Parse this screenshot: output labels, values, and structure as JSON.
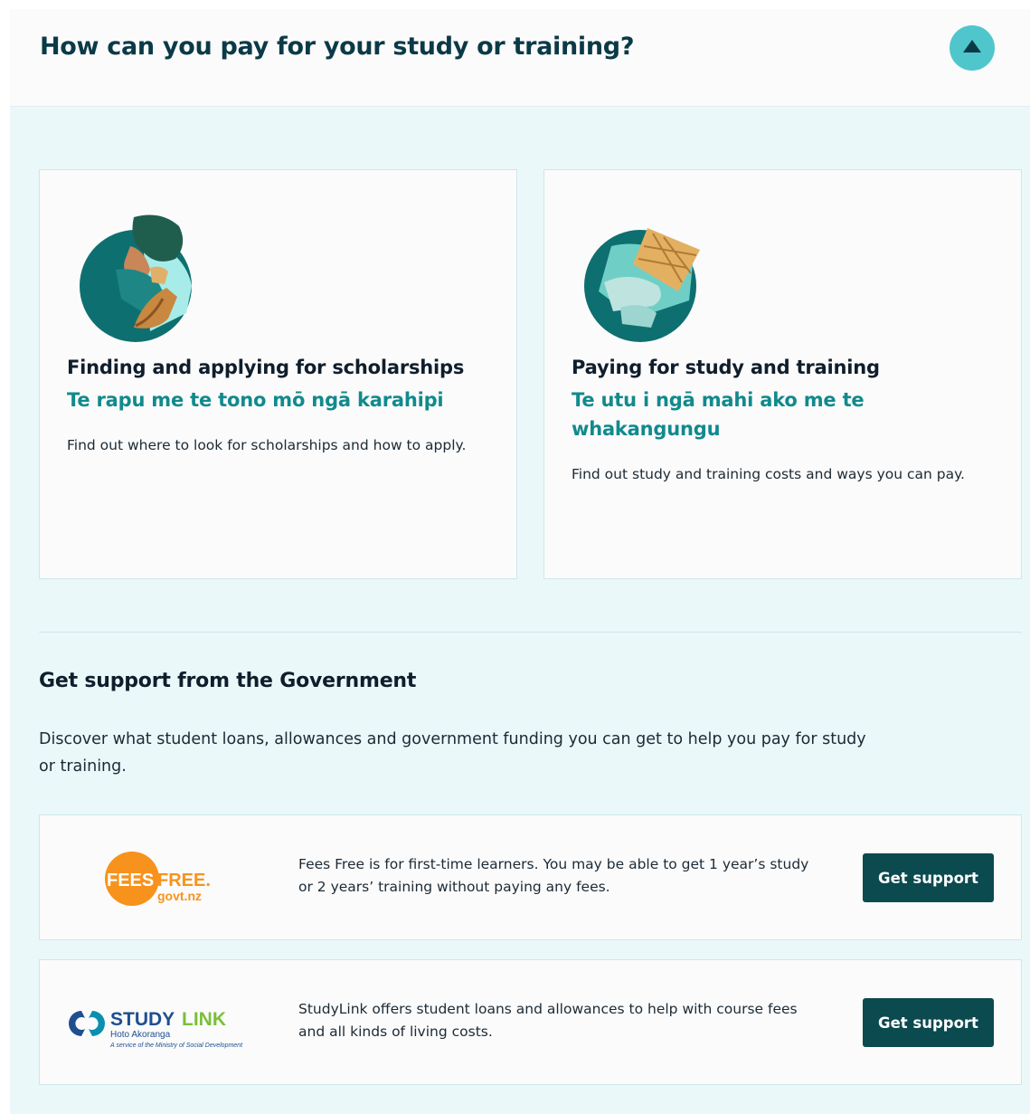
{
  "accordion": {
    "title": "How can you pay for your study or training?"
  },
  "cards": [
    {
      "title_en": "Finding and applying for scholarships",
      "title_mi": "Te rapu me te tono mō ngā karahipi",
      "description": "Find out where to look for scholarships and how to apply."
    },
    {
      "title_en": "Paying for study and training",
      "title_mi": "Te utu i ngā mahi ako me te whakangungu",
      "description": "Find out study and training costs and ways you can pay."
    }
  ],
  "support": {
    "title": "Get support from the Government",
    "description": "Discover what student loans, allowances and government funding you can get to help you pay for study or training.",
    "items": [
      {
        "logo_text": "FEESFREE.",
        "logo_sub": "govt.nz",
        "text": "Fees Free is for first-time learners. You may be able to get 1 year’s study or 2 years’ training without paying any fees.",
        "button": "Get support"
      },
      {
        "logo_text": "STUDYLINK",
        "logo_sub": "Hoto Akoranga",
        "logo_sub2": "A service of the Ministry of Social Development",
        "text": "StudyLink offers student loans and allowances to help with course fees and all kinds of living costs.",
        "button": "Get support"
      }
    ]
  },
  "colors": {
    "accent_teal": "#4fc6cc",
    "heading_teal": "#118a8d",
    "button_dark": "#0b4a4e",
    "panel_bg": "#eaf8fa",
    "fees_orange": "#f7931d"
  },
  "icons": {
    "collapse": "triangle-up-icon"
  }
}
